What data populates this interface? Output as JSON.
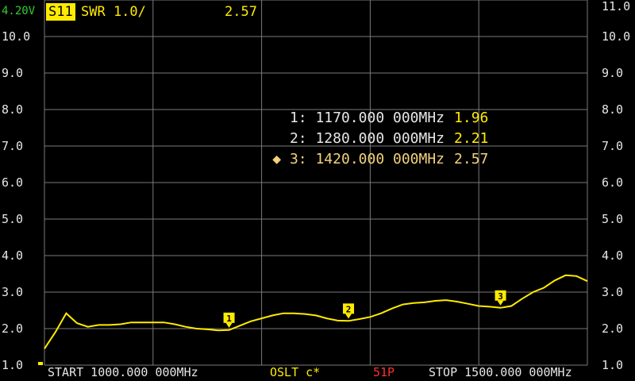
{
  "status": {
    "battery": "4.20V"
  },
  "trace": {
    "channel": "S11",
    "format": "SWR 1.0/",
    "value": "2.57"
  },
  "footer": {
    "start": "START 1000.000 000MHz",
    "calibration": "OSLT c*",
    "points": "51P",
    "stop": "STOP 1500.000 000MHz"
  },
  "markers": [
    {
      "label": "1: 1170.000 000MHz",
      "value": "1.96",
      "active": false
    },
    {
      "label": "2: 1280.000 000MHz",
      "value": "2.21",
      "active": false
    },
    {
      "label": "◆ 3: 1420.000 000MHz",
      "value": "2.57",
      "active": true
    }
  ],
  "colors": {
    "trace": "#ffeb00",
    "grid": "#7a7a7a",
    "battery": "#33cc33",
    "points": "#ff3030"
  },
  "chart_data": {
    "type": "line",
    "x_range": [
      1000,
      1500
    ],
    "ylim": [
      1.0,
      11.0
    ],
    "yticks_left": [
      "10.0",
      "9.0",
      "8.0",
      "7.0",
      "6.0",
      "5.0",
      "4.0",
      "3.0",
      "2.0",
      "1.0"
    ],
    "yticks_right": [
      "11.0",
      "10.0",
      "9.0",
      "8.0",
      "7.0",
      "6.0",
      "5.0",
      "4.0",
      "3.0",
      "2.0",
      "1.0"
    ],
    "grid": true,
    "series": [
      {
        "x": [
          1000,
          1010,
          1020,
          1030,
          1040,
          1050,
          1060,
          1070,
          1080,
          1090,
          1100,
          1110,
          1120,
          1130,
          1140,
          1150,
          1160,
          1170,
          1180,
          1190,
          1200,
          1210,
          1220,
          1230,
          1240,
          1250,
          1260,
          1270,
          1280,
          1290,
          1300,
          1310,
          1320,
          1330,
          1340,
          1350,
          1360,
          1370,
          1380,
          1390,
          1400,
          1410,
          1420,
          1430,
          1440,
          1450,
          1460,
          1470,
          1480,
          1490,
          1500
        ],
        "values": [
          1.45,
          1.9,
          2.42,
          2.15,
          2.05,
          2.1,
          2.1,
          2.12,
          2.17,
          2.17,
          2.17,
          2.17,
          2.12,
          2.05,
          2.0,
          1.98,
          1.95,
          1.96,
          2.08,
          2.2,
          2.28,
          2.36,
          2.42,
          2.42,
          2.4,
          2.36,
          2.28,
          2.22,
          2.21,
          2.26,
          2.32,
          2.42,
          2.55,
          2.66,
          2.7,
          2.72,
          2.76,
          2.78,
          2.74,
          2.68,
          2.62,
          2.6,
          2.57,
          2.62,
          2.82,
          3.0,
          3.12,
          3.32,
          3.46,
          3.44,
          3.3
        ]
      }
    ],
    "markers": [
      {
        "id": "1",
        "x": 1170,
        "value": 1.96
      },
      {
        "id": "2",
        "x": 1280,
        "value": 2.21
      },
      {
        "id": "3",
        "x": 1420,
        "value": 2.57
      }
    ]
  }
}
